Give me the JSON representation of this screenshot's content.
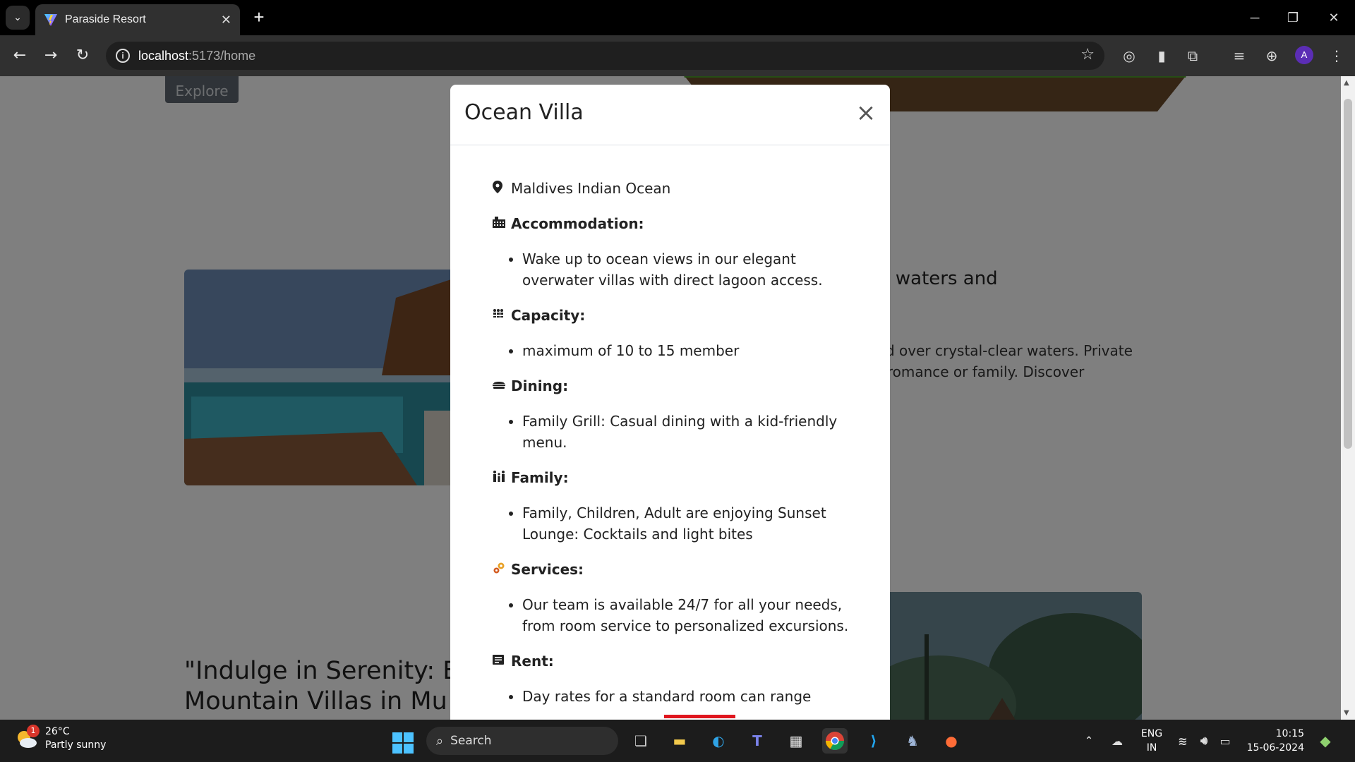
{
  "browser": {
    "tab_title": "Paraside Resort",
    "url_host": "localhost",
    "url_path": ":5173/home"
  },
  "page": {
    "explore_button": "Explore",
    "bg_heading": "ear waters and",
    "bg_paragraph_line1": "ned over crystal-clear waters. Private",
    "bg_paragraph_line2": "or romance or family. Discover",
    "bg_quote_line1": "\"Indulge in Serenity: E",
    "bg_quote_line2": "Mountain Villas in Mu"
  },
  "modal": {
    "title": "Ocean Villa",
    "close_symbol": "×",
    "location": "Maldives Indian Ocean",
    "sections": [
      {
        "heading": "Accommodation:",
        "items": [
          "Wake up to ocean views in our elegant overwater villas with direct lagoon access."
        ]
      },
      {
        "heading": "Capacity:",
        "items": [
          "maximum of 10 to 15 member"
        ]
      },
      {
        "heading": "Dining:",
        "items": [
          "Family Grill: Casual dining with a kid-friendly menu."
        ]
      },
      {
        "heading": "Family:",
        "items": [
          "Family, Children, Adult are enjoying Sunset Lounge: Cocktails and light bites"
        ]
      },
      {
        "heading": "Services:",
        "items": [
          "Our team is available 24/7 for all your needs, from room service to personalized excursions."
        ]
      },
      {
        "heading": "Rent:",
        "items": [
          "Day rates for a standard room can range"
        ]
      }
    ]
  },
  "taskbar": {
    "weather_temp": "26°C",
    "weather_desc": "Partly sunny",
    "weather_badge": "1",
    "search_label": "Search",
    "lang_line1": "ENG",
    "lang_line2": "IN",
    "time": "10:15",
    "date": "15-06-2024"
  },
  "colors": {
    "accent_underline": "#e0161e",
    "start_blue": "#4cc2ff"
  }
}
